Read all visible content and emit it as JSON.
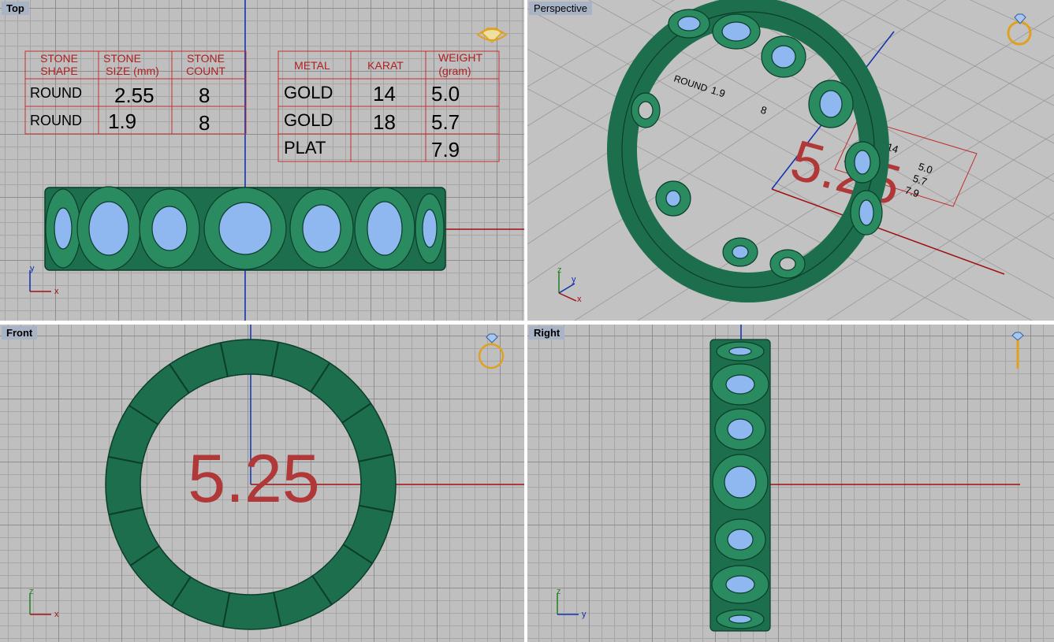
{
  "viewports": {
    "top": {
      "title": "Top"
    },
    "perspective": {
      "title": "Perspective"
    },
    "front": {
      "title": "Front"
    },
    "right": {
      "title": "Right"
    }
  },
  "axes": {
    "x": "x",
    "y": "y",
    "z": "z"
  },
  "stone_table": {
    "headers": [
      [
        "STONE",
        "SHAPE"
      ],
      [
        "STONE",
        "SIZE (mm)"
      ],
      [
        "STONE",
        "COUNT"
      ]
    ],
    "rows": [
      {
        "shape": "ROUND",
        "size": "2.55",
        "count": "8"
      },
      {
        "shape": "ROUND",
        "size": "1.9",
        "count": "8"
      }
    ]
  },
  "metal_table": {
    "headers": [
      [
        "METAL"
      ],
      [
        "KARAT"
      ],
      [
        "WEIGHT",
        "(gram)"
      ]
    ],
    "rows": [
      {
        "metal": "GOLD",
        "karat": "14",
        "weight": "5.0"
      },
      {
        "metal": "GOLD",
        "karat": "18",
        "weight": "5.7"
      },
      {
        "metal": "PLAT",
        "karat": "",
        "weight": "7.9"
      }
    ]
  },
  "ring_size": "5.25",
  "colors": {
    "metal": "#1f7a55",
    "metal_dark": "#0b3d2a",
    "stone": "#8fb8f0",
    "table_lines": "#c03030",
    "size_text": "#b03838",
    "x_axis": "#a01010",
    "y_axis": "#1030b0",
    "icon": "#e0a020"
  }
}
